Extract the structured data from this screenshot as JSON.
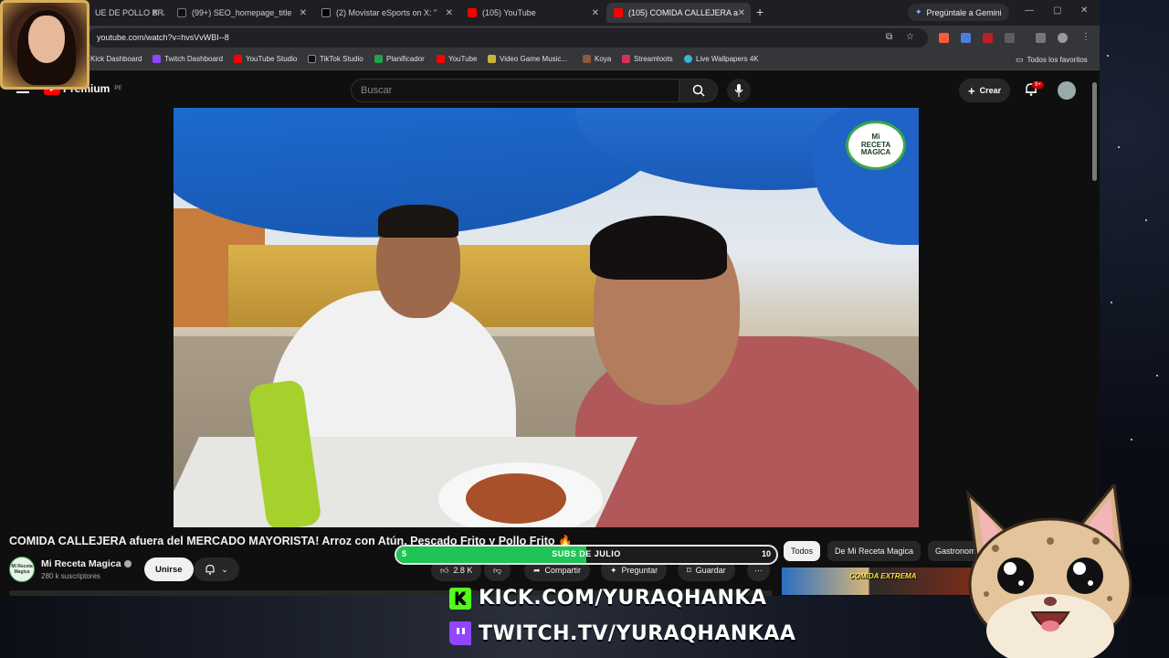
{
  "browser": {
    "tabs": [
      {
        "label": "UE DE POLLO BRA",
        "fav_color": "#ff0000",
        "active": false
      },
      {
        "label": "(99+) SEO_homepage_title",
        "fav_color": "#111111",
        "active": false
      },
      {
        "label": "(2) Movistar eSports on X: \"",
        "fav_color": "#000000",
        "active": false
      },
      {
        "label": "(105) YouTube",
        "fav_color": "#ff0000",
        "active": false
      },
      {
        "label": "(105) COMIDA CALLEJERA a",
        "fav_color": "#ff0000",
        "active": true
      }
    ],
    "gemini_label": "Pregúntale a Gemini",
    "url": "youtube.com/watch?v=hvsVvWBI--8",
    "bookmarks": [
      {
        "label": "Kick Dashboard",
        "fav_color": "#53fc18"
      },
      {
        "label": "Twitch Dashboard",
        "fav_color": "#9146ff"
      },
      {
        "label": "YouTube Studio",
        "fav_color": "#ff0000"
      },
      {
        "label": "TikTok Studio",
        "fav_color": "#111111"
      },
      {
        "label": "Planificador",
        "fav_color": "#22a34a"
      },
      {
        "label": "YouTube",
        "fav_color": "#ff0000"
      },
      {
        "label": "Video Game Music...",
        "fav_color": "#c9b23a"
      },
      {
        "label": "Koya",
        "fav_color": "#8a5a3a"
      },
      {
        "label": "Streamloots",
        "fav_color": "#d9305a"
      },
      {
        "label": "Live Wallpapers 4K",
        "fav_color": "#39b6d6"
      }
    ],
    "all_bookmarks_label": "Todos los favoritos"
  },
  "youtube": {
    "logo_text": "Premium",
    "country": "PE",
    "search_placeholder": "Buscar",
    "create_label": "Crear",
    "notif_count": "9+",
    "video_logo_lines": [
      "Mi",
      "RECETA",
      "MAGICA"
    ],
    "video_title": "COMIDA CALLEJERA afuera del MERCADO MAYORISTA! Arroz con Atún, Pescado Frito y Pollo Frito 🔥",
    "channel": {
      "name": "Mi Receta Magica",
      "subs": "280 k suscriptores",
      "avatar_text": "Mi Receta Magica"
    },
    "join_label": "Unirse",
    "actions": {
      "likes": "2.8 K",
      "share": "Compartir",
      "ask": "Preguntar",
      "save": "Guardar"
    },
    "chips": [
      "Todos",
      "De Mi Receta Magica",
      "Gastronomía"
    ],
    "thumb_label": "COMIDA EXTREMA"
  },
  "overlay": {
    "subs_goal": {
      "label": "SUBS DE JULIO",
      "min": "5",
      "max": "10",
      "progress": 0.5,
      "color": "#1fc456"
    },
    "kick_url": "KICK.COM/YURAQHANKA",
    "twitch_url": "TWITCH.TV/YURAQHANKAA"
  }
}
